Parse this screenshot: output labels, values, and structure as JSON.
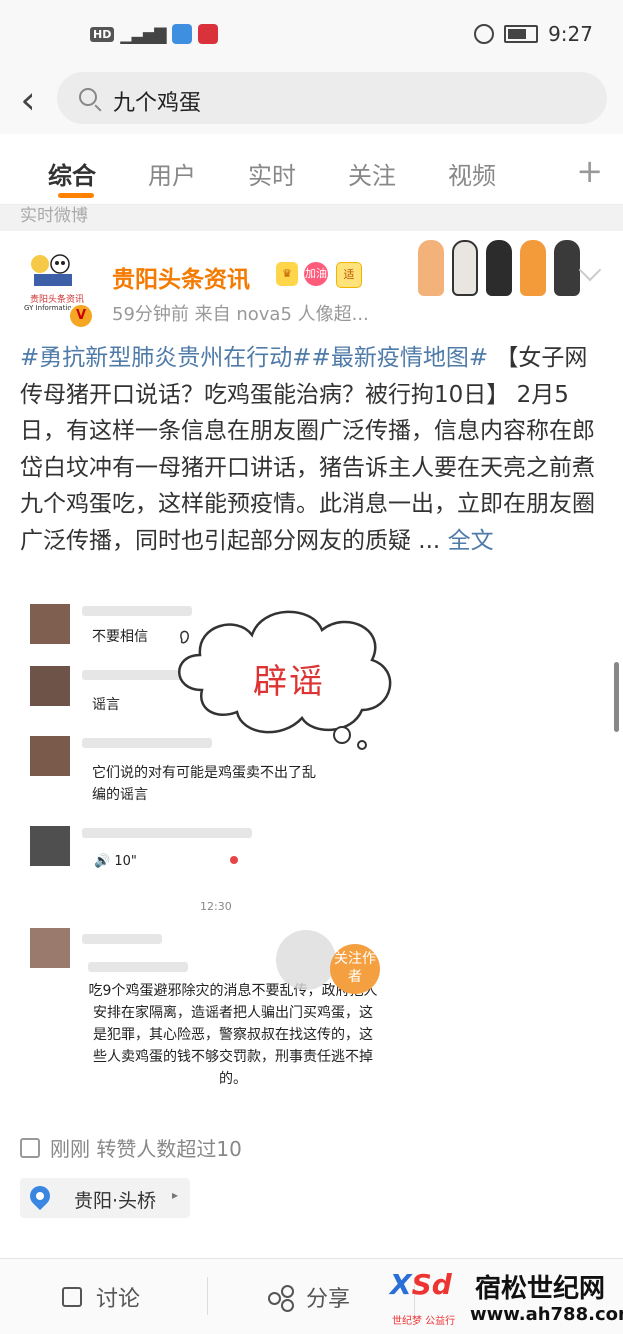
{
  "status_bar": {
    "network": "HD",
    "signal": "4G",
    "time": "9:27"
  },
  "search": {
    "query": "九个鸡蛋"
  },
  "tabs": [
    {
      "label": "综合"
    },
    {
      "label": "用户"
    },
    {
      "label": "实时"
    },
    {
      "label": "关注"
    },
    {
      "label": "视频"
    }
  ],
  "tabs_plus": "+",
  "section_label": "实时微博",
  "post": {
    "avatar_caption": "贵阳头条资讯",
    "avatar_caption_en": "GY Information",
    "verified_mark": "V",
    "author": "贵阳头条资讯",
    "badges": {
      "heart": "加油",
      "shi": "适"
    },
    "meta": "59分钟前  来自 nova5 人像超...",
    "hashtag1": "#勇抗新型肺炎贵州在行动#",
    "hashtag2": "#最新疫情地图#",
    "body": " 【女子网传母猪开口说话？吃鸡蛋能治病？被行拘10日】 2月5日，有这样一条信息在朋友圈广泛传播，信息内容称在郎岱白坟冲有一母猪开口讲话，猪告诉主人要在天亮之前煮九个鸡蛋吃，这样能预疫情。此消息一出，立即在朋友圈广泛传播，同时也引起部分网友的质疑 ...",
    "more_label": "全文"
  },
  "embed": {
    "rumor_label": "辟谣",
    "msg1": "不要相信",
    "msg2": "谣言",
    "msg3": "它们说的对有可能是鸡蛋卖不出了乱编的谣言",
    "voice": "🔊 10\"",
    "time": "12:30",
    "forward": "吃9个鸡蛋避邪除灾的消息不要乱传，政府把人安排在家隔离，造谣者把人骗出门买鸡蛋，这是犯罪，其心险恶，警察叔叔在找这传的，这些人卖鸡蛋的钱不够交罚款，刑事责任逃不掉的。",
    "follow_badge": "关注作者"
  },
  "repost": {
    "text": "刚刚 转赞人数超过10"
  },
  "location": {
    "text": "贵阳·头桥",
    "arrow": "▸"
  },
  "toolbar": {
    "comment": "讨论",
    "share": "分享"
  },
  "watermark": {
    "logo_x": "X",
    "logo_s": "Sd",
    "sub": "世纪梦 公益行",
    "title": "宿松世纪网",
    "url": "www.ah788.com"
  },
  "colors": {
    "accent": "#ff8200",
    "username": "#f47a00",
    "link": "#4f7ba9",
    "rumor": "#dd3333"
  }
}
